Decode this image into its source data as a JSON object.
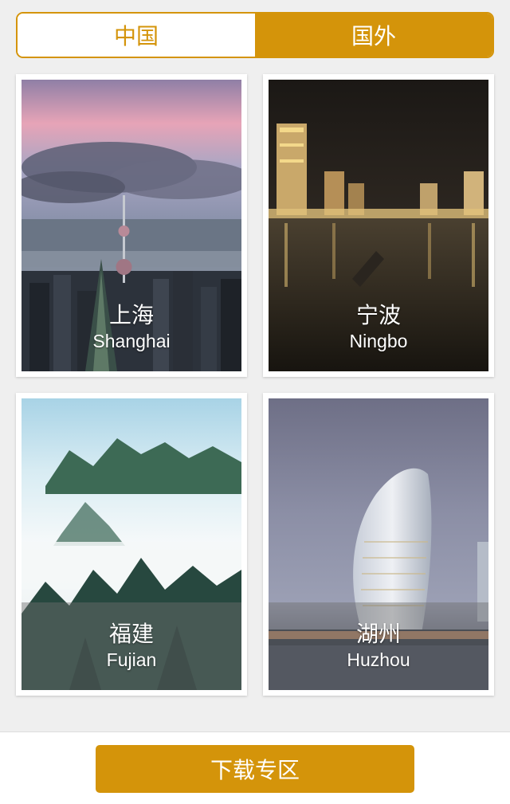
{
  "tabs": [
    {
      "label": "中国",
      "selected": false
    },
    {
      "label": "国外",
      "selected": true
    }
  ],
  "cities": [
    {
      "cn": "上海",
      "en": "Shanghai"
    },
    {
      "cn": "宁波",
      "en": "Ningbo"
    },
    {
      "cn": "福建",
      "en": "Fujian"
    },
    {
      "cn": "湖州",
      "en": "Huzhou"
    }
  ],
  "footer": {
    "download_label": "下载专区"
  },
  "colors": {
    "accent": "#d4940a",
    "background": "#efefef"
  }
}
